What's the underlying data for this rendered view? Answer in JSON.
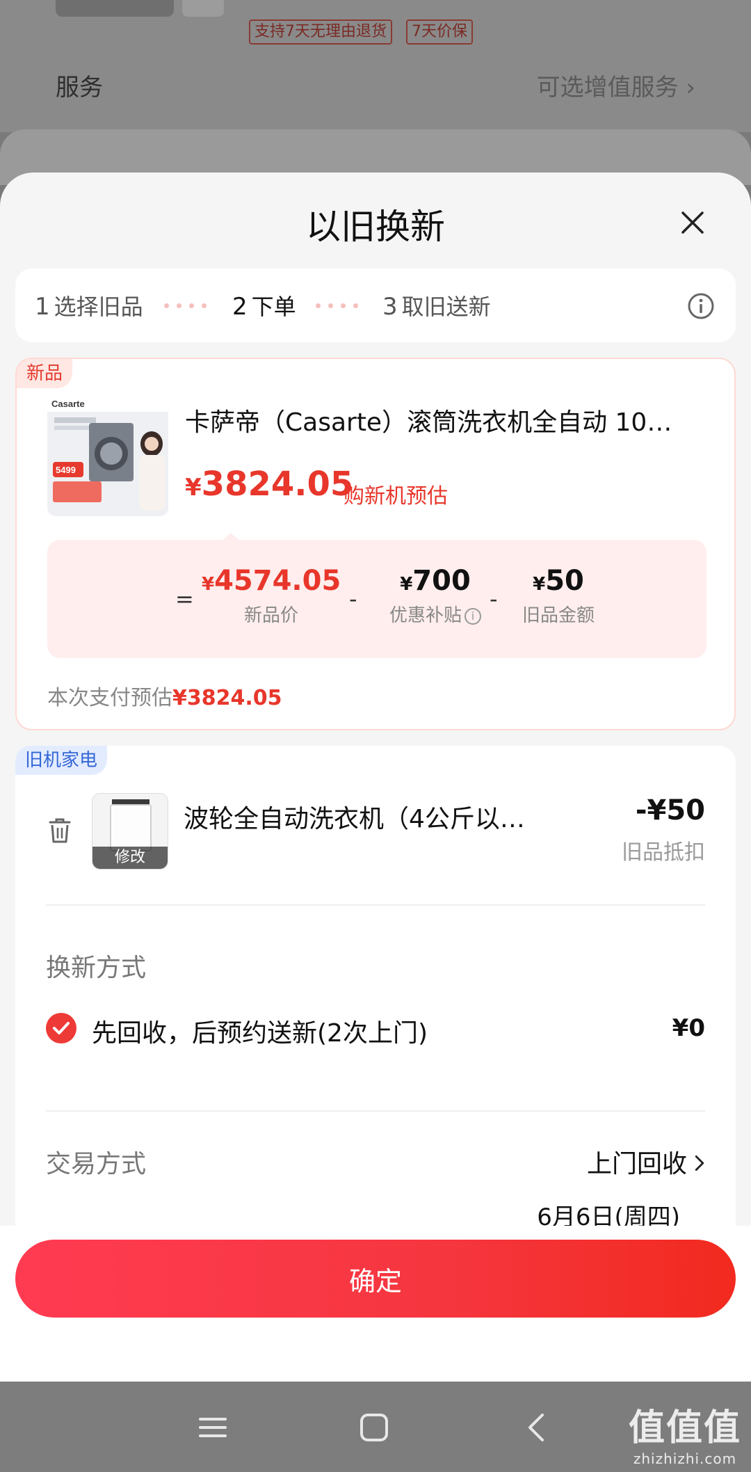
{
  "background": {
    "tags": [
      "支持7天无理由退货",
      "7天价保"
    ],
    "service_label": "服务",
    "service_value": "可选增值服务 ›"
  },
  "modal": {
    "title": "以旧换新",
    "close_icon": "close-icon",
    "steps": [
      {
        "num": "1",
        "label": "选择旧品"
      },
      {
        "num": "2",
        "label": "下单"
      },
      {
        "num": "3",
        "label": "取旧送新"
      }
    ],
    "active_step": 2,
    "info_icon": "info-icon"
  },
  "new_product": {
    "tag": "新品",
    "title": "卡萨帝（Casarte）滚筒洗衣机全自动 10…",
    "currency": "¥",
    "price": "3824.05",
    "price_note": "购新机预估",
    "breakdown": {
      "equals": "=",
      "minus": "-",
      "new_price": {
        "currency": "¥",
        "value": "4574.05",
        "label": "新品价"
      },
      "subsidy": {
        "currency": "¥",
        "value": "700",
        "label": "优惠补贴"
      },
      "old_value": {
        "currency": "¥",
        "value": "50",
        "label": "旧品金额"
      }
    },
    "pay_label": "本次支付预估",
    "pay_amount": "¥3824.05",
    "image_texts": {
      "brand": "Casarte",
      "price": "5499"
    }
  },
  "old_appliance": {
    "tag": "旧机家电",
    "title": "波轮全自动洗衣机（4公斤以…",
    "edit_label": "修改",
    "deduction": "-¥50",
    "deduction_label": "旧品抵扣",
    "renew_method_label": "换新方式",
    "renew_option": "先回收，后预约送新(2次上门)",
    "renew_option_price": "¥0",
    "trade_method_label": "交易方式",
    "trade_method_value": "上门回收",
    "trade_date": "6月6日(周四)"
  },
  "actions": {
    "confirm_label": "确定"
  },
  "system_nav": {
    "buttons": [
      "recents-icon",
      "home-icon",
      "back-icon"
    ],
    "watermark": "值值值",
    "watermark_url": "zhizhizhi.com"
  },
  "colors": {
    "accent": "#e8362b",
    "button_start": "#ff3b52",
    "button_end": "#f22a1f",
    "tag_blue": "#3466d6"
  }
}
